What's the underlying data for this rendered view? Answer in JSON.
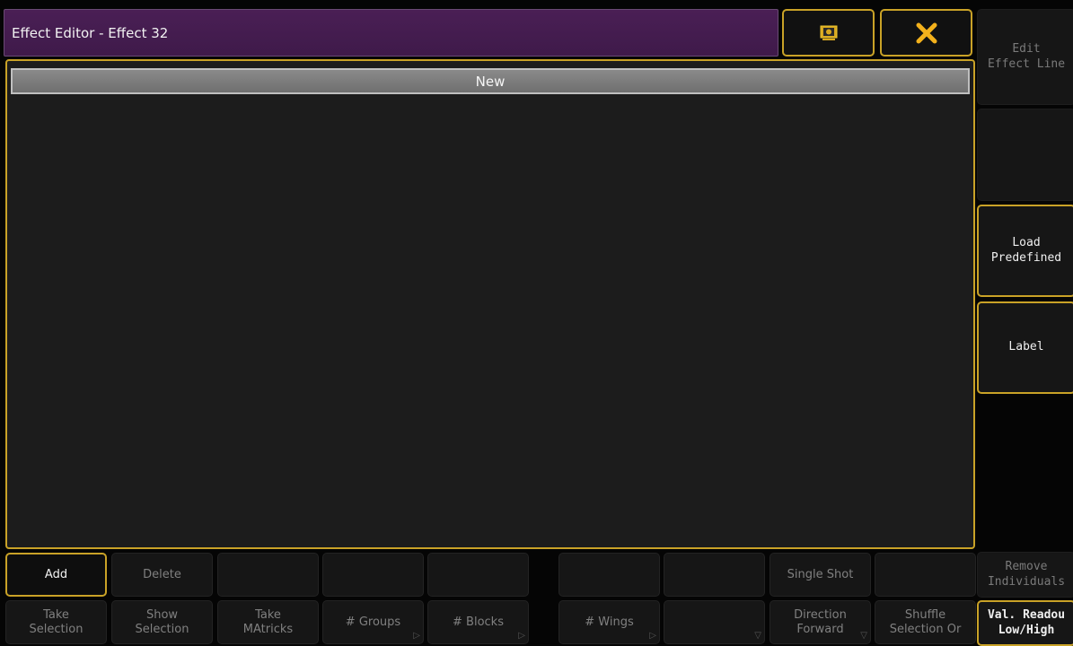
{
  "window": {
    "title": "Effect Editor - Effect 32",
    "accent_color": "#c9a227",
    "title_bg_color": "#4a1f55"
  },
  "title_buttons": {
    "screen_icon": "screen-icon",
    "close_icon": "close-icon"
  },
  "main": {
    "new_row_label": "New"
  },
  "side": {
    "edit_effect_line": "Edit\nEffect Line",
    "empty": "",
    "load_predefined": "Load\nPredefined",
    "label": "Label",
    "remove_individuals": "Remove\nIndividuals",
    "val_readout": "Val. Readou\nLow/High"
  },
  "row1": {
    "add": "Add",
    "delete": "Delete",
    "empty": "",
    "single_shot": "Single Shot"
  },
  "row2": {
    "take_selection": "Take\nSelection",
    "show_selection": "Show\nSelection",
    "take_matricks": "Take\nMAtricks",
    "groups": "# Groups",
    "blocks": "# Blocks",
    "wings": "# Wings",
    "empty": "",
    "direction": "Direction\nForward",
    "shuffle": "Shuffle\nSelection Or"
  }
}
